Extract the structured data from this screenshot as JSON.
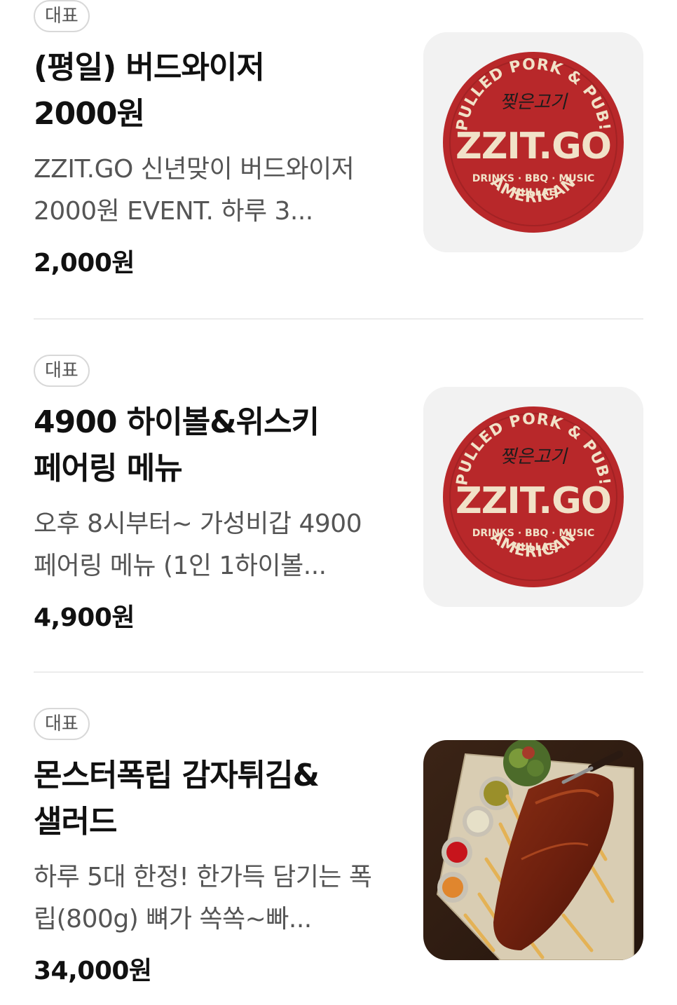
{
  "menu": {
    "items": [
      {
        "badge": "대표",
        "title": "(평일) 버드와이저 2000원",
        "description": "ZZIT.GO 신년맞이 버드와이저 2000원 EVENT. 하루 3...",
        "price": "2,000원",
        "image_type": "logo"
      },
      {
        "badge": "대표",
        "title": "4900 하이볼&위스키 페어링 메뉴",
        "description": "오후 8시부터~ 가성비갑 4900 페어링 메뉴 (1인 1하이볼...",
        "price": "4,900원",
        "image_type": "logo"
      },
      {
        "badge": "대표",
        "title": "몬스터폭립 감자튀김&샐러드",
        "description": "하루 5대 한정! 한가득 담기는 폭립(800g) 뼈가 쏙쏙~빠...",
        "price": "34,000원",
        "image_type": "food-photo"
      }
    ]
  },
  "logo": {
    "arc_top": "PULLED PORK & PUB!",
    "script": "찢은고기",
    "name": "ZZIT.GO",
    "tagline": "DRINKS · BBQ · MUSIC",
    "location": "MULLAE",
    "arc_bottom": "AMERICAN",
    "colors": {
      "badge_red": "#b8282a",
      "text_cream": "#f1e2c8",
      "background": "#f2f2f2"
    }
  }
}
